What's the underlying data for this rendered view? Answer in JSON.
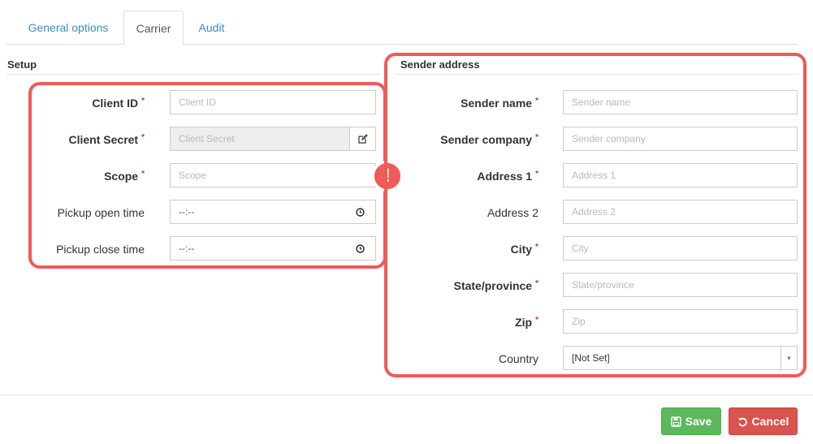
{
  "tabs": [
    {
      "label": "General options",
      "active": false
    },
    {
      "label": "Carrier",
      "active": true
    },
    {
      "label": "Audit",
      "active": false
    }
  ],
  "setup": {
    "title": "Setup",
    "client_id": {
      "label": "Client ID",
      "required": "*",
      "placeholder": "Client ID"
    },
    "client_secret": {
      "label": "Client Secret",
      "required": "*",
      "placeholder": "Client Secret"
    },
    "scope": {
      "label": "Scope",
      "required": "*",
      "placeholder": "Scope"
    },
    "pickup_open": {
      "label": "Pickup open time",
      "value": "--:--"
    },
    "pickup_close": {
      "label": "Pickup close time",
      "value": "--:--"
    }
  },
  "sender": {
    "title": "Sender address",
    "sender_name": {
      "label": "Sender name",
      "required": "*",
      "placeholder": "Sender name"
    },
    "sender_company": {
      "label": "Sender company",
      "required": "*",
      "placeholder": "Sender company"
    },
    "address1": {
      "label": "Address 1",
      "required": "*",
      "placeholder": "Address 1"
    },
    "address2": {
      "label": "Address 2",
      "placeholder": "Address 2"
    },
    "city": {
      "label": "City",
      "required": "*",
      "placeholder": "City"
    },
    "state": {
      "label": "State/province",
      "required": "*",
      "placeholder": "State/province"
    },
    "zip": {
      "label": "Zip",
      "required": "*",
      "placeholder": "Zip"
    },
    "country": {
      "label": "Country",
      "selected": "[Not Set]"
    }
  },
  "warning_mark": "!",
  "buttons": {
    "save": "Save",
    "cancel": "Cancel"
  },
  "colors": {
    "highlight": "#f05a57",
    "save": "#5cb85c",
    "cancel": "#d9534f",
    "link": "#3c8dbc"
  }
}
